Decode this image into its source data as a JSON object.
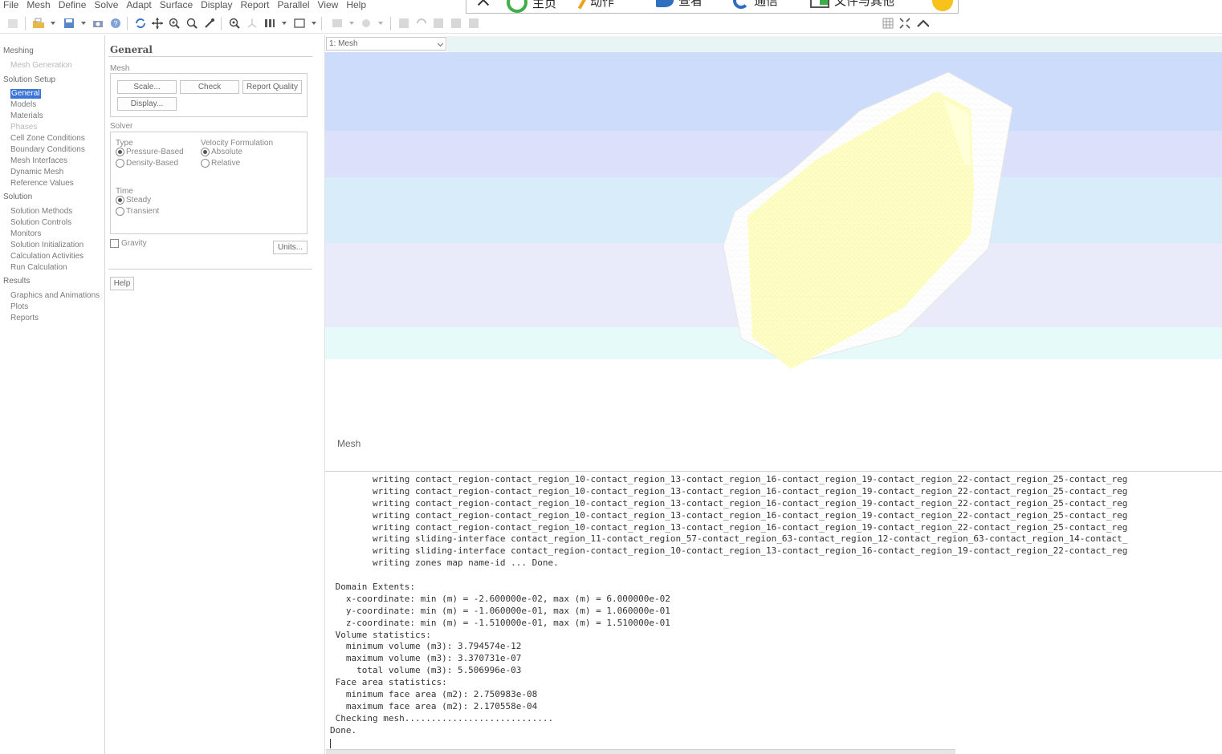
{
  "menu": {
    "items": [
      "File",
      "Mesh",
      "Define",
      "Solve",
      "Adapt",
      "Surface",
      "Display",
      "Report",
      "Parallel",
      "View",
      "Help"
    ]
  },
  "floating_bar": {
    "items": [
      {
        "icon": "close-icon",
        "label": ""
      },
      {
        "icon": "refresh-icon",
        "label": "主页"
      },
      {
        "icon": "pencil-icon",
        "label": "动作"
      },
      {
        "icon": "view-icon",
        "label": "查看"
      },
      {
        "icon": "phone-icon",
        "label": "通信"
      },
      {
        "icon": "folder-icon",
        "label": "文件与其他"
      },
      {
        "icon": "emoji-icon",
        "label": ""
      }
    ]
  },
  "nav": {
    "meshing": "Meshing",
    "mesh_generation": "Mesh Generation",
    "solution_setup": "Solution Setup",
    "general": "General",
    "models": "Models",
    "materials": "Materials",
    "phases": "Phases",
    "cell_zone_conditions": "Cell Zone Conditions",
    "boundary_conditions": "Boundary Conditions",
    "mesh_interfaces": "Mesh Interfaces",
    "dynamic_mesh": "Dynamic Mesh",
    "reference_values": "Reference Values",
    "solution": "Solution",
    "solution_methods": "Solution Methods",
    "solution_controls": "Solution Controls",
    "monitors": "Monitors",
    "solution_initialization": "Solution Initialization",
    "calculation_activities": "Calculation Activities",
    "run_calculation": "Run Calculation",
    "results": "Results",
    "graphics_and_animations": "Graphics and Animations",
    "plots": "Plots",
    "reports": "Reports"
  },
  "panel": {
    "title": "General",
    "mesh_group": "Mesh",
    "scale_button": "Scale...",
    "check_button": "Check",
    "report_quality_button": "Report Quality",
    "display_button": "Display...",
    "solver_group": "Solver",
    "type_label": "Type",
    "pressure_based": "Pressure-Based",
    "density_based": "Density-Based",
    "velocity_label": "Velocity Formulation",
    "absolute": "Absolute",
    "relative": "Relative",
    "time_label": "Time",
    "steady": "Steady",
    "transient": "Transient",
    "gravity": "Gravity",
    "units_button": "Units...",
    "help_button": "Help"
  },
  "graphics": {
    "view_select": "1: Mesh",
    "view_label": "Mesh",
    "colors": {
      "mesh_fill": "#ffffc4",
      "mesh_outline": "#ffffff",
      "band_1": "#ccdcfa",
      "band_2": "#dde0fa",
      "band_3": "#d8ecfa",
      "band_4": "#e9eafa",
      "band_5": "#e6fafa"
    }
  },
  "console": {
    "lines": [
      "        writing contact_region-contact_region_10-contact_region_13-contact_region_16-contact_region_19-contact_region_22-contact_region_25-contact_reg",
      "        writing contact_region-contact_region_10-contact_region_13-contact_region_16-contact_region_19-contact_region_22-contact_region_25-contact_reg",
      "        writing contact_region-contact_region_10-contact_region_13-contact_region_16-contact_region_19-contact_region_22-contact_region_25-contact_reg",
      "        writing contact_region-contact_region_10-contact_region_13-contact_region_16-contact_region_19-contact_region_22-contact_region_25-contact_reg",
      "        writing contact_region-contact_region_10-contact_region_13-contact_region_16-contact_region_19-contact_region_22-contact_region_25-contact_reg",
      "        writing sliding-interface contact_region_11-contact_region_57-contact_region_63-contact_region_12-contact_region_63-contact_region_14-contact_",
      "        writing sliding-interface contact_region-contact_region_10-contact_region_13-contact_region_16-contact_region_19-contact_region_22-contact_reg",
      "        writing zones map name-id ... Done.",
      "",
      " Domain Extents:",
      "   x-coordinate: min (m) = -2.600000e-02, max (m) = 6.000000e-02",
      "   y-coordinate: min (m) = -1.060000e-01, max (m) = 1.060000e-01",
      "   z-coordinate: min (m) = -1.510000e-01, max (m) = 1.510000e-01",
      " Volume statistics:",
      "   minimum volume (m3): 3.794574e-12",
      "   maximum volume (m3): 3.370731e-07",
      "     total volume (m3): 5.506996e-03",
      " Face area statistics:",
      "   minimum face area (m2): 2.750983e-08",
      "   maximum face area (m2): 2.170558e-04",
      " Checking mesh............................",
      "Done."
    ]
  }
}
